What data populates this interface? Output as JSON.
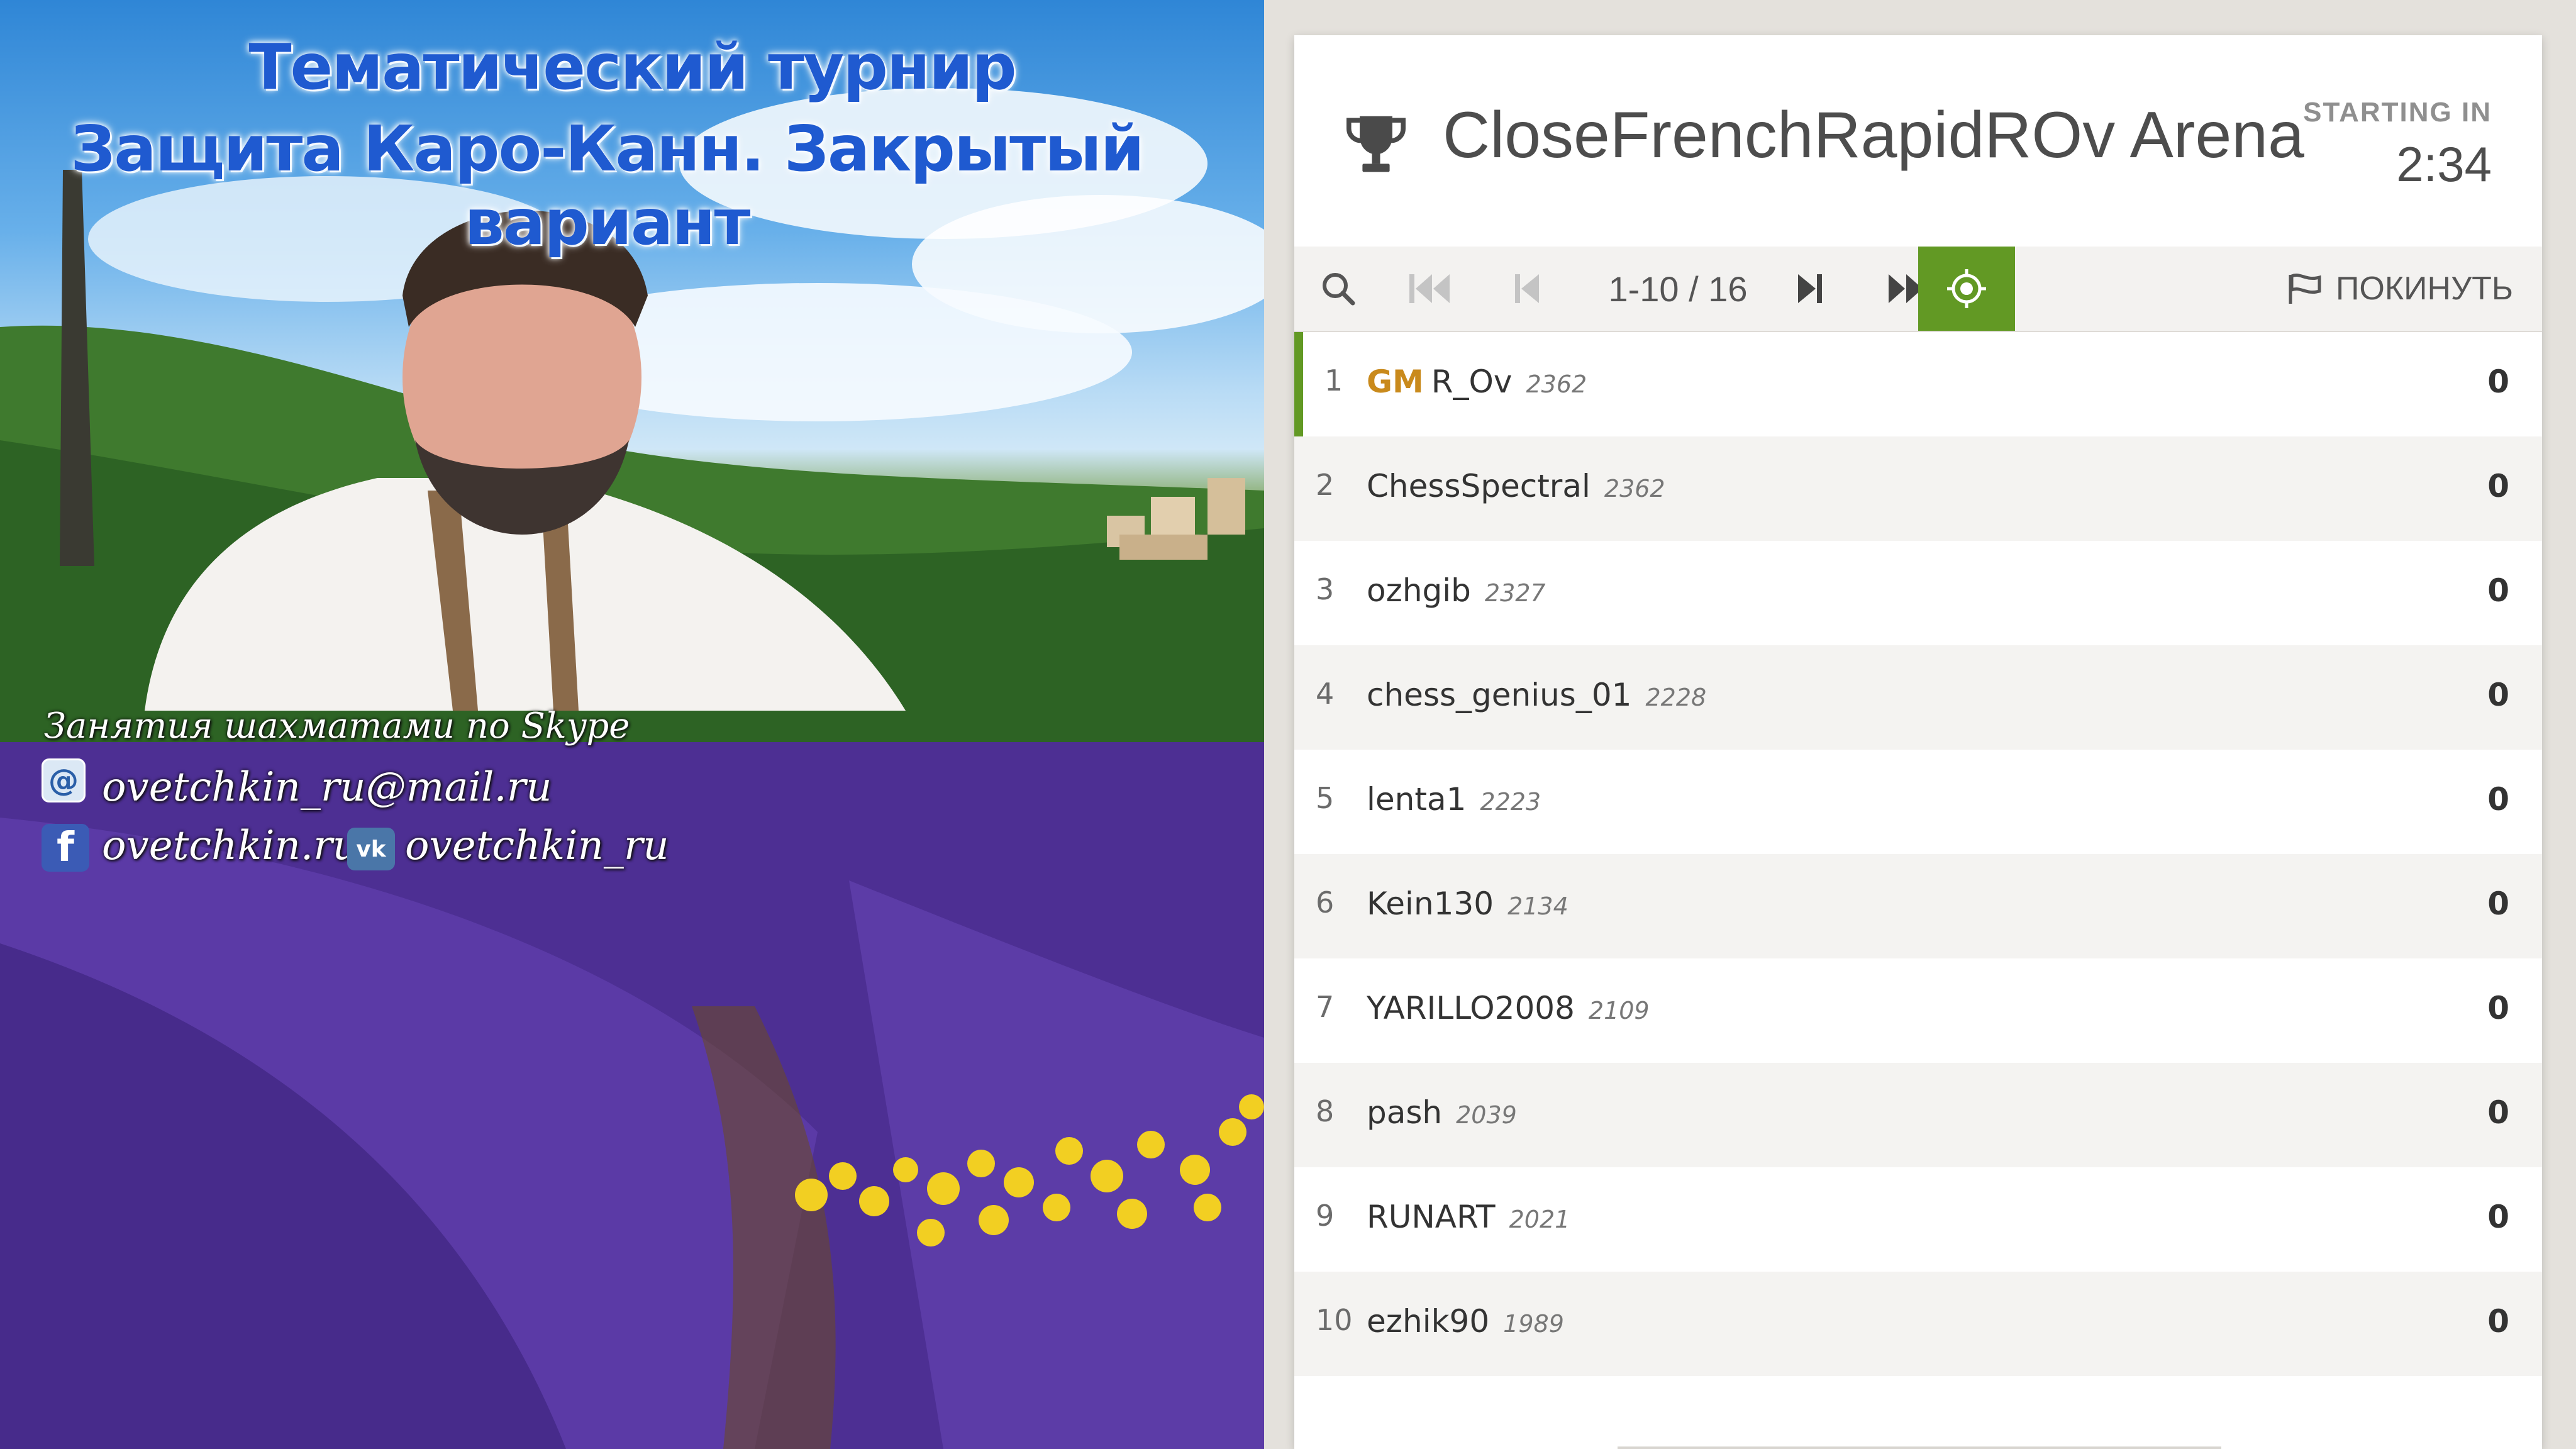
{
  "stream": {
    "title_line_1": "Тематический турнир",
    "title_line_2": "Защита Каро-Канн. Закрытый вариант",
    "lessons_text": "Занятия шахматами по Skype",
    "email": "ovetchkin_ru@mail.ru",
    "website": "ovetchkin.ru",
    "vk": "ovetchkin_ru",
    "icons": [
      "mail-icon",
      "facebook-icon",
      "vk-icon"
    ]
  },
  "tournament": {
    "name": "CloseFrenchRapidROv Arena",
    "starting_label": "STARTING IN",
    "countdown": "2:34",
    "icon": "trophy-icon"
  },
  "pager": {
    "range": "1-10 / 16",
    "leave_label": "ПОКИНУТЬ",
    "icons": [
      "search-icon",
      "first-page-icon",
      "prev-page-icon",
      "next-page-icon",
      "last-page-icon",
      "focus-icon",
      "flag-icon"
    ],
    "accent_color": "#629924"
  },
  "standings": [
    {
      "rank": "1",
      "title": "GM",
      "name": "R_Ov",
      "rating": "2362",
      "score": "0"
    },
    {
      "rank": "2",
      "title": "",
      "name": "ChessSpectral",
      "rating": "2362",
      "score": "0"
    },
    {
      "rank": "3",
      "title": "",
      "name": "ozhgib",
      "rating": "2327",
      "score": "0"
    },
    {
      "rank": "4",
      "title": "",
      "name": "chess_genius_01",
      "rating": "2228",
      "score": "0"
    },
    {
      "rank": "5",
      "title": "",
      "name": "lenta1",
      "rating": "2223",
      "score": "0"
    },
    {
      "rank": "6",
      "title": "",
      "name": "Kein130",
      "rating": "2134",
      "score": "0"
    },
    {
      "rank": "7",
      "title": "",
      "name": "YARILLO2008",
      "rating": "2109",
      "score": "0"
    },
    {
      "rank": "8",
      "title": "",
      "name": "pash",
      "rating": "2039",
      "score": "0"
    },
    {
      "rank": "9",
      "title": "",
      "name": "RUNART",
      "rating": "2021",
      "score": "0"
    },
    {
      "rank": "10",
      "title": "",
      "name": "ezhik90",
      "rating": "1989",
      "score": "0"
    }
  ]
}
